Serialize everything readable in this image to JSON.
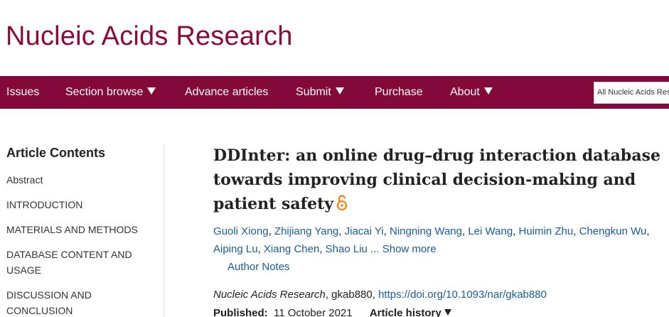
{
  "journal": {
    "title": "Nucleic Acids Research"
  },
  "nav": {
    "items": [
      {
        "label": "Issues",
        "dropdown": false
      },
      {
        "label": "Section browse",
        "dropdown": true
      },
      {
        "label": "Advance articles",
        "dropdown": false
      },
      {
        "label": "Submit",
        "dropdown": true
      },
      {
        "label": "Purchase",
        "dropdown": false
      },
      {
        "label": "About",
        "dropdown": true
      }
    ],
    "search_scope": "All Nucleic Acids Research"
  },
  "sidebar": {
    "heading": "Article Contents",
    "items": [
      "Abstract",
      "INTRODUCTION",
      "MATERIALS AND METHODS",
      "DATABASE CONTENT AND USAGE",
      "DISCUSSION AND CONCLUSION"
    ]
  },
  "article": {
    "title": "DDInter: an online drug–drug interaction database towards improving clinical decision-making and patient safety",
    "authors": [
      "Guoli Xiong",
      "Zhijiang Yang",
      "Jiacai Yi",
      "Ningning Wang",
      "Lei Wang",
      "Huimin Zhu",
      "Chengkun Wu",
      "Aiping Lu",
      "Xiang Chen",
      "Shao Liu"
    ],
    "show_more": "... Show more",
    "author_notes": "Author Notes",
    "journal_name": "Nucleic Acids Research",
    "article_id": ", gkab880, ",
    "doi": "https://doi.org/10.1093/nar/gkab880",
    "published_label": "Published:",
    "published_date": "11 October 2021",
    "history_label": "Article history"
  },
  "colors": {
    "brand": "#82093a",
    "link": "#1a5c9c",
    "open_access": "#f68212"
  }
}
